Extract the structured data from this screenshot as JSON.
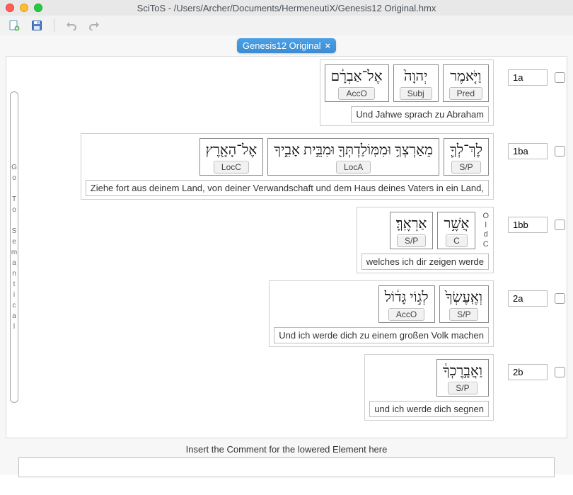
{
  "window": {
    "title": "SciToS - /Users/Archer/Documents/HermeneutiX/Genesis12 Original.hmx"
  },
  "tab": {
    "label": "Genesis12 Original",
    "close": "×"
  },
  "side": {
    "chars": [
      "G",
      "o",
      " ",
      "T",
      "o",
      " ",
      "S",
      "e",
      "m",
      "a",
      "n",
      "t",
      "i",
      "c",
      "a",
      "l"
    ]
  },
  "clauses": [
    {
      "id": "1a",
      "ref": "1a",
      "words": [
        {
          "heb": "וַיֹּ֤אמֶר",
          "role": "Pred"
        },
        {
          "heb": "יְהוָה֙",
          "role": "Subj"
        },
        {
          "heb": "אֶל־אַבְרָ֔ם",
          "role": "AccO"
        }
      ],
      "translation": "Und Jahwe sprach zu Abraham"
    },
    {
      "id": "1ba",
      "ref": "1ba",
      "words": [
        {
          "heb": "לֶךְ־לְךָ֛",
          "role": "S/P"
        },
        {
          "heb": "מֵאַרְצְךָ֥ וּמִמּֽוֹלַדְתְּךָ֖ וּמִבֵּ֣ית אָבִ֑יךָ",
          "role": "LocA"
        },
        {
          "heb": "אֶל־הָאָ֖רֶץ",
          "role": "LocC"
        }
      ],
      "translation": "Ziehe fort aus deinem Land, von deiner Verwandschaft und dem Haus deines Vaters in ein Land,"
    },
    {
      "id": "1bb",
      "ref": "1bb",
      "marker": "OldC",
      "words": [
        {
          "heb": "אֲשֶׁ֥ר",
          "role": "C"
        },
        {
          "heb": "אַרְאֶֽךָּ׃",
          "role": "S/P"
        }
      ],
      "translation": "welches ich dir zeigen werde"
    },
    {
      "id": "2a",
      "ref": "2a",
      "words": [
        {
          "heb": "וְאֶֽעֶשְׂךָ֙",
          "role": "S/P"
        },
        {
          "heb": "לְג֣וֹי גָּד֔וֹל",
          "role": "AccO"
        }
      ],
      "translation": "Und ich werde dich zu einem großen Volk machen"
    },
    {
      "id": "2b",
      "ref": "2b",
      "words": [
        {
          "heb": "וַאֲבָ֣רֶכְךָ֔",
          "role": "S/P"
        }
      ],
      "translation": "und ich werde dich segnen"
    }
  ],
  "comment": {
    "label": "Insert the Comment for the lowered Element here",
    "value": ""
  }
}
